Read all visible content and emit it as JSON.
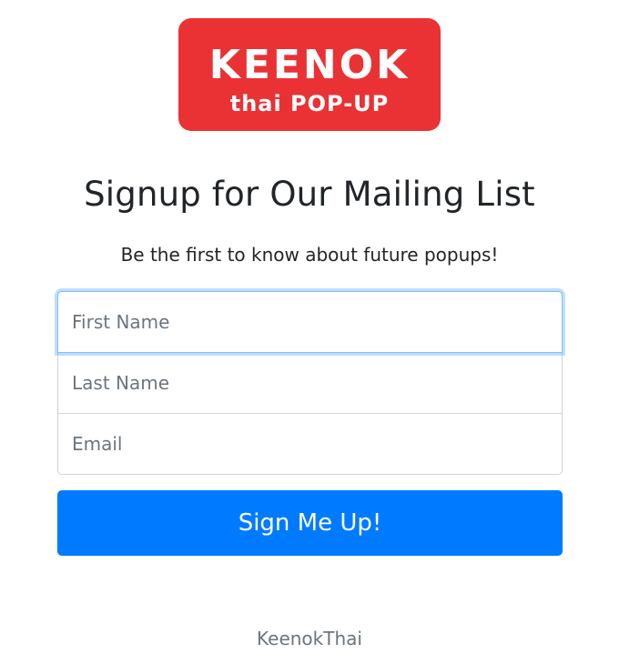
{
  "logo": {
    "line1": "KEENOK",
    "line2": "thai POP-UP",
    "background_color": "#ea3235",
    "text_color": "#ffffff"
  },
  "heading": "Signup for Our Mailing List",
  "subheading": "Be the first to know about future popups!",
  "form": {
    "first_name_placeholder": "First Name",
    "last_name_placeholder": "Last Name",
    "email_placeholder": "Email",
    "submit_label": "Sign Me Up!"
  },
  "footer": "KeenokThai",
  "colors": {
    "primary": "#007bff",
    "focus_border": "#80bdff",
    "input_border": "#ced4da",
    "muted_text": "#6c757d"
  }
}
